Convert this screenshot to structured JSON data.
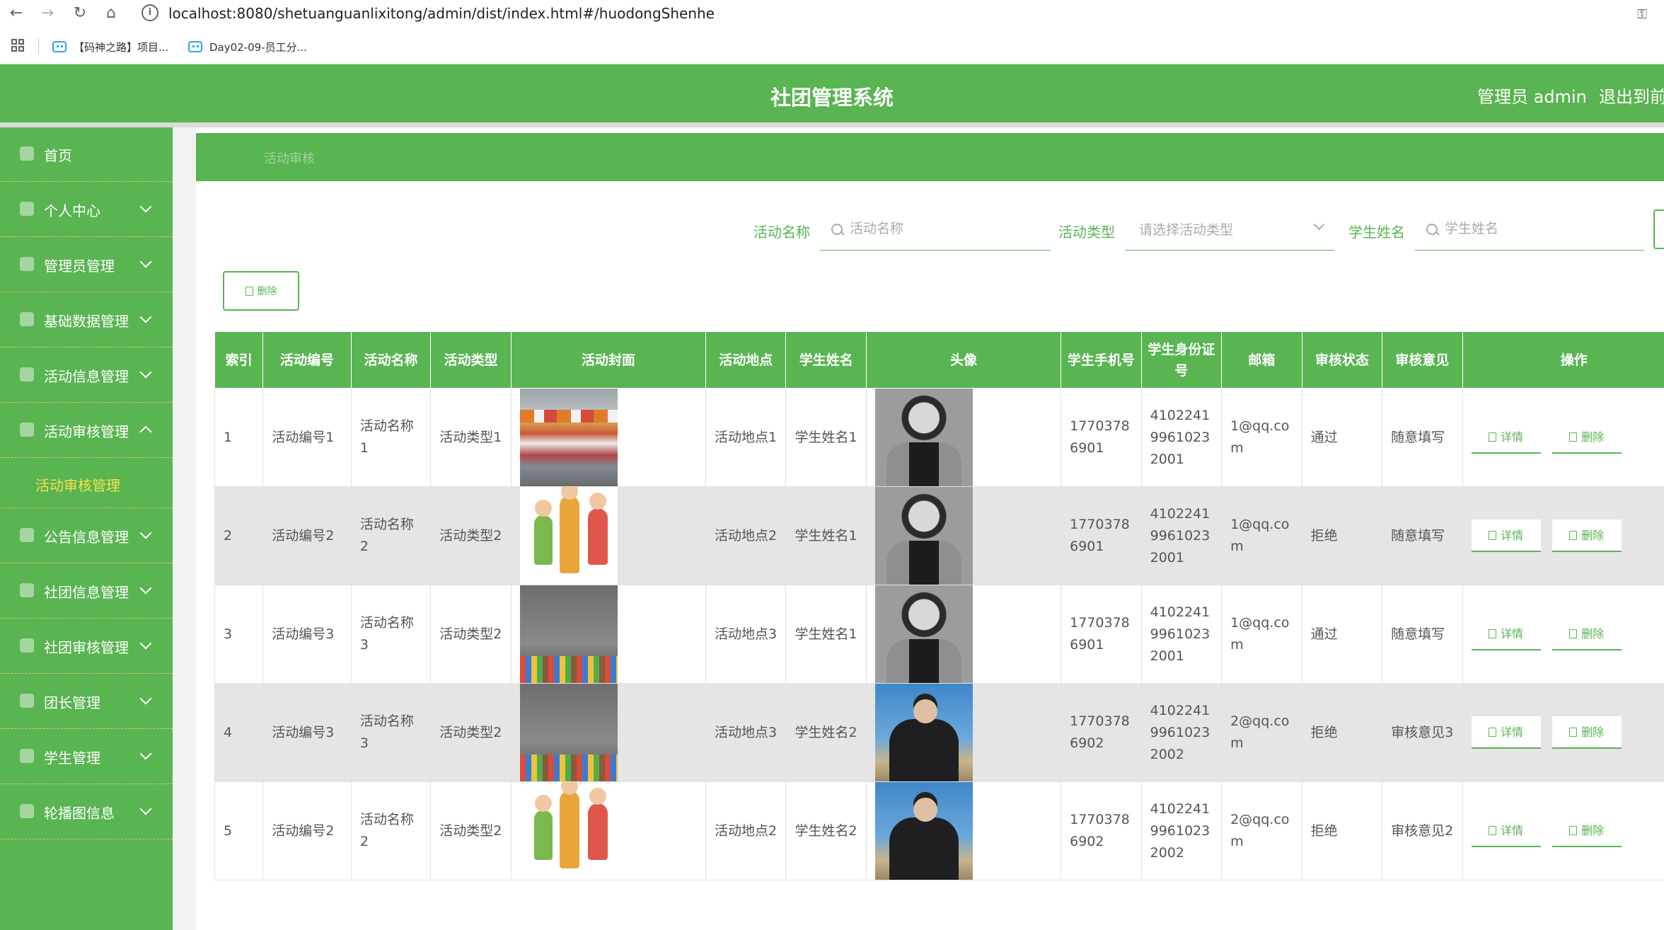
{
  "browser": {
    "url": "localhost:8080/shetuanguanlixitong/admin/dist/index.html#/huodongShenhe",
    "bookmarks": [
      "【码神之路】项目...",
      "Day02-09-员工分..."
    ]
  },
  "header": {
    "title": "社团管理系统",
    "user_label": "管理员 admin",
    "logout_label": "退出到前"
  },
  "sidebar": {
    "items": [
      {
        "label": "首页",
        "icon": "home-icon",
        "has_chevron": false
      },
      {
        "label": "个人中心",
        "icon": "user-icon",
        "has_chevron": true
      },
      {
        "label": "管理员管理",
        "icon": "user-icon",
        "has_chevron": true
      },
      {
        "label": "基础数据管理",
        "icon": "settings-icon",
        "has_chevron": true
      },
      {
        "label": "活动信息管理",
        "icon": "list-icon",
        "has_chevron": true
      },
      {
        "label": "活动审核管理",
        "icon": "user-icon",
        "has_chevron": true,
        "expanded": true
      },
      {
        "label": "公告信息管理",
        "icon": "notice-icon",
        "has_chevron": true
      },
      {
        "label": "社团信息管理",
        "icon": "list-icon",
        "has_chevron": true
      },
      {
        "label": "社团审核管理",
        "icon": "settings-icon",
        "has_chevron": true
      },
      {
        "label": "团长管理",
        "icon": "document-icon",
        "has_chevron": true
      },
      {
        "label": "学生管理",
        "icon": "send-icon",
        "has_chevron": true
      },
      {
        "label": "轮播图信息",
        "icon": "menu-icon",
        "has_chevron": true
      }
    ],
    "active_subitem": "活动审核管理"
  },
  "breadcrumb": "活动审核",
  "search": {
    "activity_name_label": "活动名称",
    "activity_name_placeholder": "活动名称",
    "activity_type_label": "活动类型",
    "activity_type_placeholder": "请选择活动类型",
    "student_name_label": "学生姓名",
    "student_name_placeholder": "学生姓名"
  },
  "toolbar": {
    "delete_label": "删除"
  },
  "table": {
    "columns": [
      "索引",
      "活动编号",
      "活动名称",
      "活动类型",
      "活动封面",
      "活动地点",
      "学生姓名",
      "头像",
      "学生手机号",
      "学生身份证号",
      "邮箱",
      "审核状态",
      "审核意见",
      "操作"
    ],
    "detail_label": "详情",
    "delete_label": "删除",
    "rows": [
      {
        "index": "1",
        "code": "活动编号1",
        "name": "活动名称1",
        "type": "活动类型1",
        "cover": "market",
        "place": "活动地点1",
        "student": "学生姓名1",
        "avatar": "portrait",
        "phone": "17703786901",
        "idcard": "410224199610232001",
        "email": "1@qq.com",
        "status": "通过",
        "opinion": "随意填写"
      },
      {
        "index": "2",
        "code": "活动编号2",
        "name": "活动名称2",
        "type": "活动类型2",
        "cover": "cartoon",
        "place": "活动地点2",
        "student": "学生姓名1",
        "avatar": "portrait",
        "phone": "17703786901",
        "idcard": "410224199610232001",
        "email": "1@qq.com",
        "status": "拒绝",
        "opinion": "随意填写"
      },
      {
        "index": "3",
        "code": "活动编号3",
        "name": "活动名称3",
        "type": "活动类型2",
        "cover": "crowd",
        "place": "活动地点3",
        "student": "学生姓名1",
        "avatar": "portrait",
        "phone": "17703786901",
        "idcard": "410224199610232001",
        "email": "1@qq.com",
        "status": "通过",
        "opinion": "随意填写"
      },
      {
        "index": "4",
        "code": "活动编号3",
        "name": "活动名称3",
        "type": "活动类型2",
        "cover": "crowd",
        "place": "活动地点3",
        "student": "学生姓名2",
        "avatar": "portrait2",
        "phone": "17703786902",
        "idcard": "410224199610232002",
        "email": "2@qq.com",
        "status": "拒绝",
        "opinion": "审核意见3"
      },
      {
        "index": "5",
        "code": "活动编号2",
        "name": "活动名称2",
        "type": "活动类型2",
        "cover": "cartoon",
        "place": "活动地点2",
        "student": "学生姓名2",
        "avatar": "portrait2",
        "phone": "17703786902",
        "idcard": "410224199610232002",
        "email": "2@qq.com",
        "status": "拒绝",
        "opinion": "审核意见2"
      }
    ]
  },
  "colors": {
    "primary": "#59b452",
    "accent_yellow": "#f5e04a",
    "row_alt": "#e6e5e5"
  }
}
